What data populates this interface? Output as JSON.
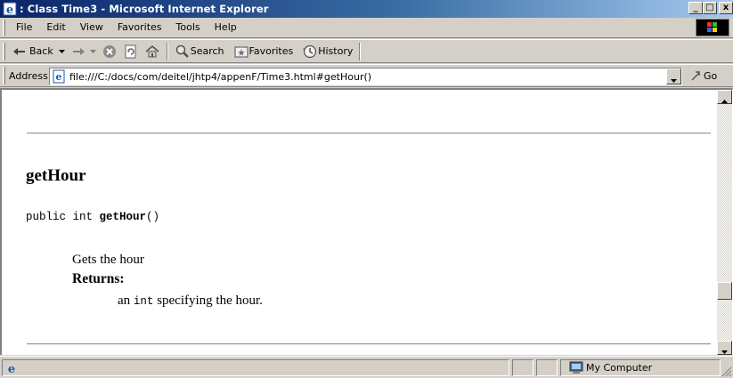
{
  "window": {
    "title": ": Class Time3 - Microsoft Internet Explorer",
    "minimize_glyph": "_",
    "maximize_glyph": "□",
    "close_glyph": "x"
  },
  "menubar": {
    "items": [
      "File",
      "Edit",
      "View",
      "Favorites",
      "Tools",
      "Help"
    ]
  },
  "toolbar": {
    "back_label": "Back",
    "search_label": "Search",
    "favorites_label": "Favorites",
    "history_label": "History"
  },
  "address": {
    "label": "Address",
    "url": "file:///C:/docs/com/deitel/jhtp4/appenF/Time3.html#getHour()",
    "go_label": "Go"
  },
  "content": {
    "method_title": "getHour",
    "signature_prefix": "public int ",
    "signature_name": "getHour",
    "signature_suffix": "()",
    "description": "Gets the hour",
    "returns_label": "Returns:",
    "returns_prefix": "an ",
    "returns_code": "int",
    "returns_suffix": " specifying the hour."
  },
  "statusbar": {
    "zone": "My Computer"
  },
  "colors": {
    "titlebar_start": "#0a246a",
    "titlebar_end": "#a6caf0",
    "chrome": "#d4d0c8"
  }
}
